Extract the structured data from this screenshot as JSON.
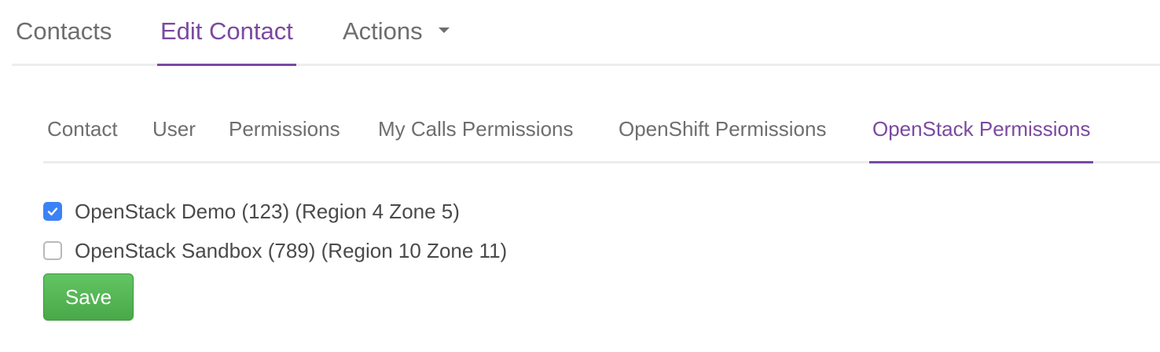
{
  "top_nav": {
    "contacts": "Contacts",
    "edit_contact": "Edit Contact",
    "actions": "Actions"
  },
  "sub_tabs": {
    "contact": "Contact",
    "user": "User",
    "permissions": "Permissions",
    "my_calls_permissions": "My Calls Permissions",
    "openshift_permissions": "OpenShift Permissions",
    "openstack_permissions": "OpenStack Permissions"
  },
  "options": [
    {
      "label": "OpenStack Demo (123) (Region 4 Zone 5)",
      "checked": true
    },
    {
      "label": "OpenStack Sandbox (789) (Region 10 Zone 11)",
      "checked": false
    }
  ],
  "save_label": "Save",
  "colors": {
    "accent": "#7b49a1",
    "checkbox_checked": "#3b82f6",
    "save_button": "#58b758"
  }
}
